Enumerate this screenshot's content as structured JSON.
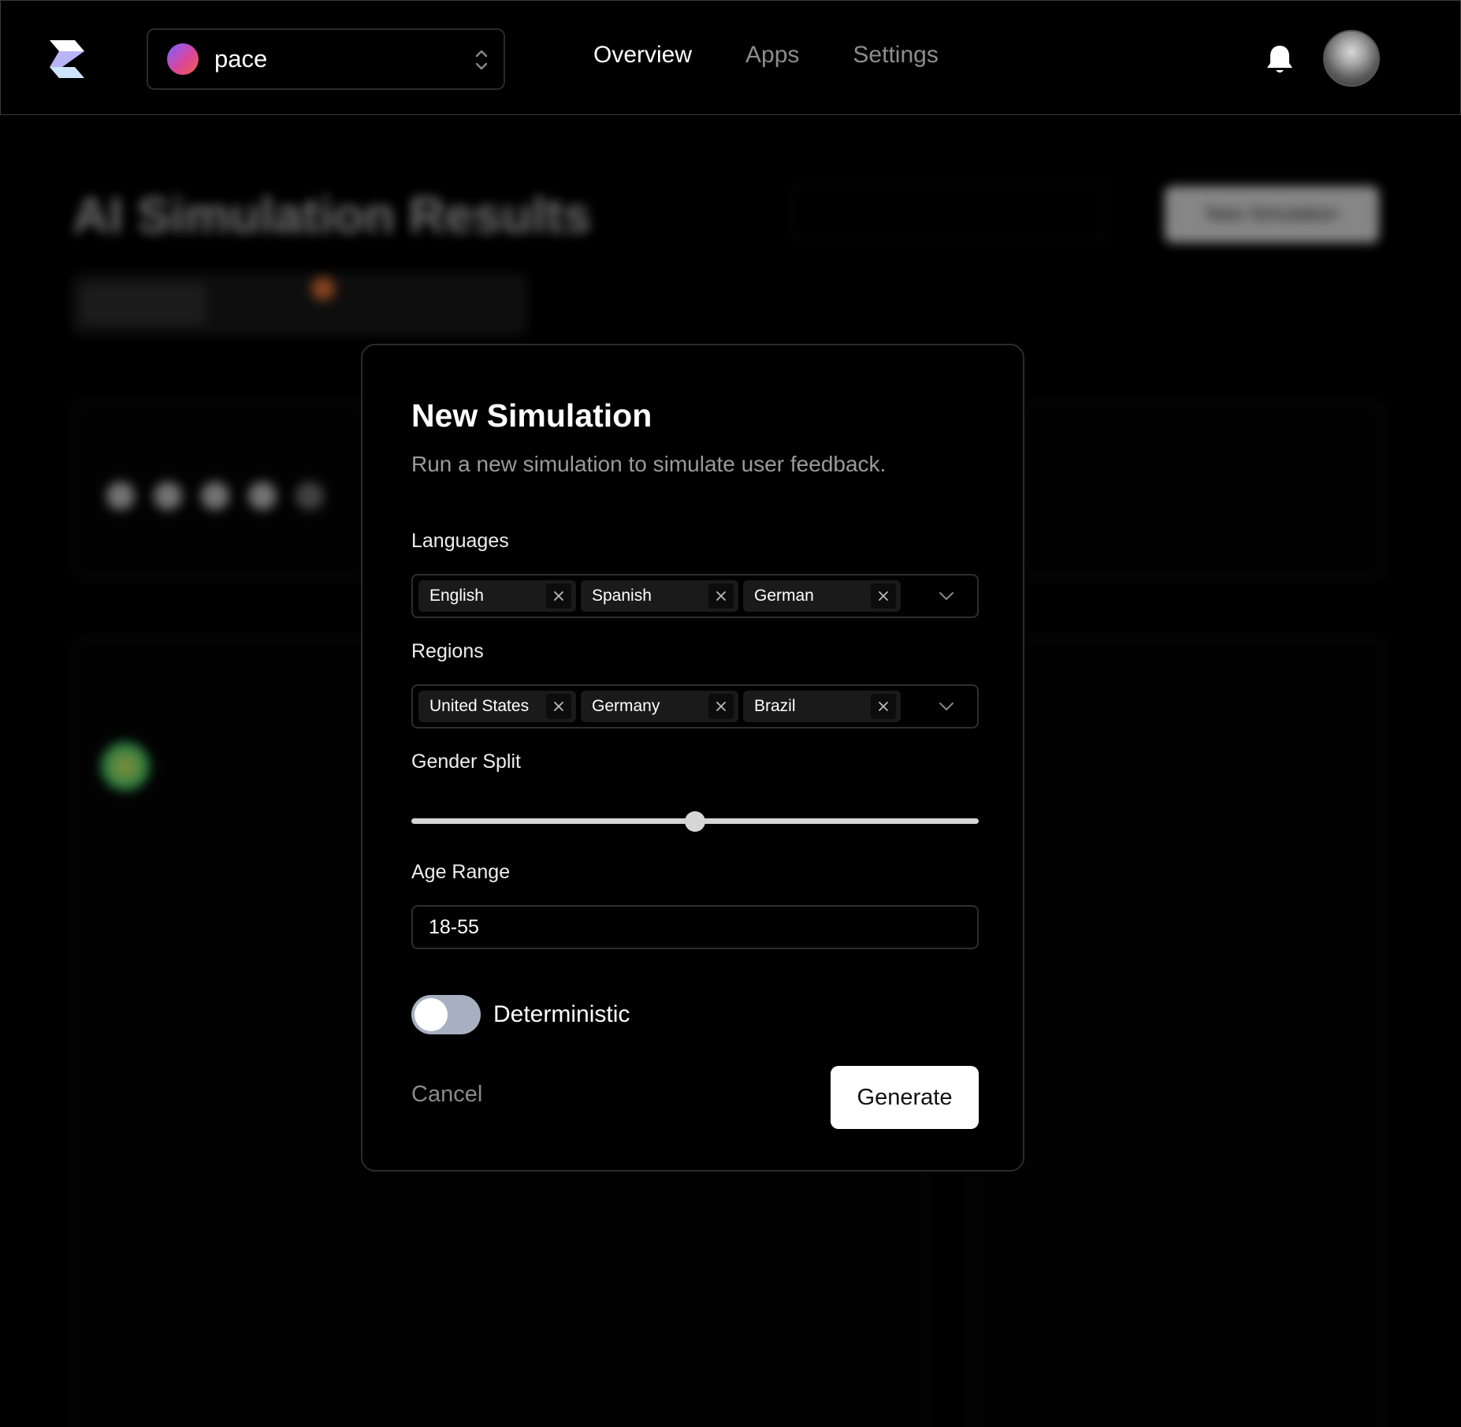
{
  "header": {
    "project": {
      "name": "pace"
    },
    "nav": [
      {
        "label": "Overview",
        "active": true
      },
      {
        "label": "Apps",
        "active": false
      },
      {
        "label": "Settings",
        "active": false
      }
    ]
  },
  "background": {
    "page_title": "AI Simulation Results",
    "new_simulation_label": "New Simulation"
  },
  "modal": {
    "title": "New Simulation",
    "description": "Run a new simulation to simulate user feedback.",
    "languages": {
      "label": "Languages",
      "selected": [
        "English",
        "Spanish",
        "German"
      ]
    },
    "regions": {
      "label": "Regions",
      "selected": [
        "United States",
        "Germany",
        "Brazil"
      ]
    },
    "gender_split": {
      "label": "Gender Split",
      "value": 0.5
    },
    "age_range": {
      "label": "Age Range",
      "value": "18-55"
    },
    "deterministic": {
      "label": "Deterministic",
      "enabled": false
    },
    "cancel_label": "Cancel",
    "generate_label": "Generate"
  },
  "colors": {
    "background": "#000000",
    "toggle_track": "#a7b0c0",
    "chip": "#1a1a1a",
    "muted_text": "#9a9a9a"
  }
}
